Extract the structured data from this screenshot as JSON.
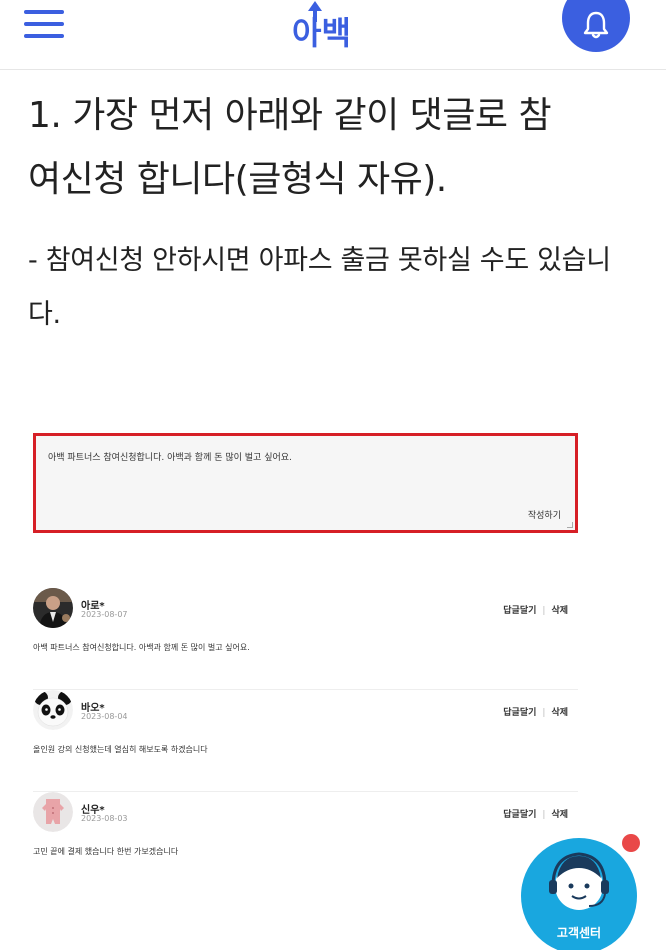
{
  "header": {
    "logo_text": "아백",
    "menu_icon": "hamburger-icon",
    "notification_icon": "bell-icon",
    "accent_color": "#3b5fe0"
  },
  "content": {
    "step_title_line1": "1. 가장 먼저 아래와 같이 댓글로 참",
    "step_title_line2": "여신청 합니다(글형식 자유).",
    "note_line1": "- 참여신청 안하시면 아파스 출금 못하실 수도 있습니",
    "note_line2": "다."
  },
  "comment_form": {
    "value": "아백 파트너스 참여신청합니다. 아백과 함께 돈 많이 벌고 싶어요.",
    "submit_label": "작성하기",
    "highlight_color": "#d61f26"
  },
  "comments": [
    {
      "name": "아로*",
      "date": "2023-08-07",
      "body": "아백 파트너스 참여신청합니다. 아백과 함께 돈 많이 벌고 싶어요.",
      "reply_label": "답글달기",
      "delete_label": "삭제"
    },
    {
      "name": "바오*",
      "date": "2023-08-04",
      "body": "올인원 강의 신청했는데 열심히 해보도록 하겠습니다",
      "reply_label": "답글달기",
      "delete_label": "삭제"
    },
    {
      "name": "신우*",
      "date": "2023-08-03",
      "body": "고민 끝에 결제 했습니다 한번 가보겠습니다",
      "reply_label": "답글달기",
      "delete_label": "삭제"
    }
  ],
  "customer_center": {
    "label": "고객센터",
    "icon": "headset-agent-icon",
    "color": "#19a7df"
  }
}
